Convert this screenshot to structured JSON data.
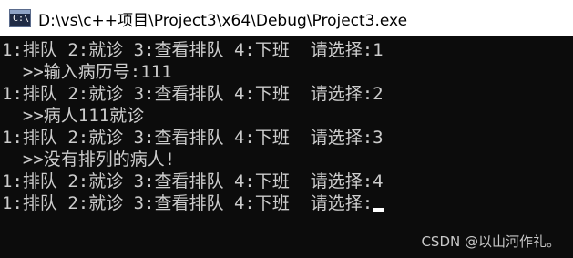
{
  "window": {
    "title": "D:\\vs\\c++项目\\Project3\\x64\\Debug\\Project3.exe",
    "icon_text": "C:\\"
  },
  "console": {
    "lines": [
      "1:排队 2:就诊 3:查看排队 4:下班  请选择:1",
      "  >>输入病历号:111",
      "1:排队 2:就诊 3:查看排队 4:下班  请选择:2",
      "  >>病人111就诊",
      "1:排队 2:就诊 3:查看排队 4:下班  请选择:3",
      "  >>没有排列的病人!",
      "1:排队 2:就诊 3:查看排队 4:下班  请选择:4",
      "1:排队 2:就诊 3:查看排队 4:下班  请选择:"
    ]
  },
  "watermark": "CSDN @以山河作礼。",
  "colors": {
    "background": "#0c0c0c",
    "text": "#cccccc",
    "titlebar": "#ffffff"
  }
}
